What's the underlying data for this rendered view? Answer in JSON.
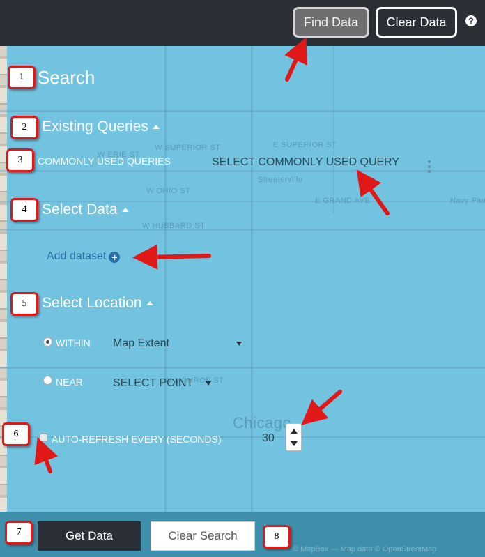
{
  "toolbar": {
    "find_data_label": "Find Data",
    "clear_data_label": "Clear Data",
    "help_icon": "?"
  },
  "map": {
    "labels": [
      "Streeterville",
      "E SUPERIOR ST",
      "W SUPERIOR ST",
      "W ERIE ST",
      "W OHIO ST",
      "E GRAND AVE",
      "W HUBBARD ST",
      "W MONROE ST",
      "Chicago",
      "Navy Pier"
    ]
  },
  "panel": {
    "title": "Search",
    "existing_queries": {
      "heading": "Existing Queries",
      "commonly_used_label": "COMMONLY USED QUERIES",
      "select_value": "SELECT COMMONLY USED QUERY"
    },
    "select_data": {
      "heading": "Select Data",
      "add_dataset_label": "Add dataset"
    },
    "select_location": {
      "heading": "Select Location",
      "within_label": "WITHIN",
      "within_value": "Map Extent",
      "near_label": "NEAR",
      "near_value": "SELECT POINT"
    },
    "auto_refresh": {
      "label": "AUTO-REFRESH EVERY (SECONDS)",
      "value": "30"
    }
  },
  "footer": {
    "get_data_label": "Get Data",
    "clear_search_label": "Clear Search",
    "attribution": "© MapBox — Map data © OpenStreetMap"
  },
  "annotations": [
    "1",
    "2",
    "3",
    "4",
    "5",
    "6",
    "7",
    "8"
  ],
  "colors": {
    "topbar": "#2b2f36",
    "map": "#72c3e0",
    "annotation_red": "#e01818",
    "link": "#2a6fa8"
  }
}
